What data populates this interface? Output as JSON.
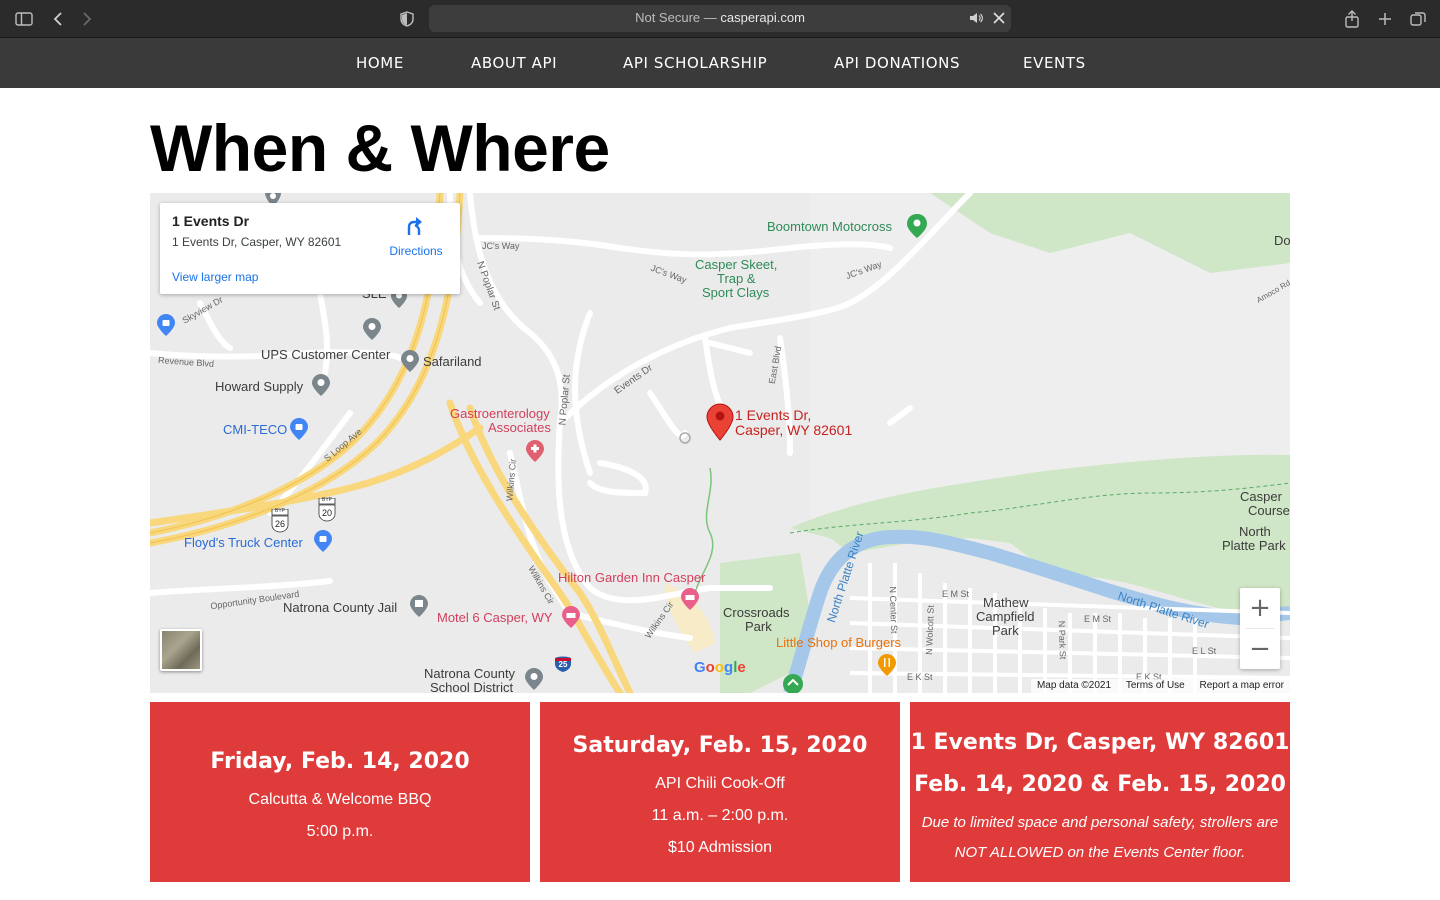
{
  "browser": {
    "url_prefix": "Not Secure — ",
    "url_host": "casperapi.com"
  },
  "nav": {
    "items": [
      "HOME",
      "ABOUT API",
      "API SCHOLARSHIP",
      "API DONATIONS",
      "EVENTS"
    ]
  },
  "page": {
    "title": "When & Where"
  },
  "map": {
    "info": {
      "name": "1 Events Dr",
      "address": "1 Events Dr, Casper, WY 82601",
      "directions": "Directions",
      "larger_map": "View larger map"
    },
    "pin_label_1": "1 Events Dr,",
    "pin_label_2": "Casper, WY 82601",
    "places": {
      "boomtown": "Boomtown Motocross",
      "skeet1": "Casper Skeet,",
      "skeet2": "Trap &",
      "skeet3": "Sport Clays",
      "ups": "UPS Customer Center",
      "safariland": "Safariland",
      "howard": "Howard Supply",
      "cmi": "CMI-TECO",
      "gastro1": "Gastroenterology",
      "gastro2": "Associates",
      "floyds": "Floyd's Truck Center",
      "hilton": "Hilton Garden Inn Casper",
      "natrona_jail": "Natrona County Jail",
      "motel6": "Motel 6 Casper, WY",
      "crossroads1": "Crossroads",
      "crossroads2": "Park",
      "little_shop": "Little Shop of Burgers",
      "mathew1": "Mathew",
      "mathew2": "Campfield",
      "mathew3": "Park",
      "natrona_sd1": "Natrona County",
      "natrona_sd2": "School District",
      "north_platte_park1": "North",
      "north_platte_park2": "Platte Park",
      "casper_course1": "Casper",
      "casper_course2": "Course",
      "do": "Do",
      "sle": "SLE"
    },
    "roads": {
      "jcs_way": "JC's Way",
      "n_poplar": "N Poplar St",
      "events_dr": "Events Dr",
      "east_blvd": "East Blvd",
      "revenue": "Revenue Blvd",
      "skyview": "Skyview Dr",
      "s_loop": "S Loop Ave",
      "wilkins": "Wilkins Cir",
      "opportunity": "Opportunity Boulevard",
      "north_platte_river": "North Platte River",
      "n_center": "N Center St",
      "n_wolcott": "N Wolcott St",
      "n_park": "N Park St",
      "e_m_st": "E M St",
      "e_l_st": "E L St",
      "e_k_st": "E K St",
      "amoco": "Amoco Rd",
      "byp26": "26",
      "byp20": "20",
      "i25": "25",
      "byp": "BYP"
    },
    "attribution": [
      "Map data ©2021",
      "Terms of Use",
      "Report a map error"
    ],
    "google": "Google"
  },
  "events": [
    {
      "date": "Friday, Feb. 14, 2020",
      "lines": [
        "Calcutta & Welcome BBQ",
        "5:00 p.m."
      ]
    },
    {
      "date": "Saturday, Feb. 15, 2020",
      "lines": [
        "API Chili Cook-Off",
        "11 a.m. – 2:00 p.m.",
        "$10 Admission"
      ]
    },
    {
      "address": "1 Events Dr, Casper, WY 82601",
      "dates": "Feb. 14, 2020 & Feb. 15, 2020",
      "note_1": "Due to limited space and personal safety, strollers are",
      "note_2": "NOT ALLOWED on the Events Center floor."
    }
  ],
  "colors": {
    "nav_bg": "#3a3a3a",
    "card_red": "#e03b3b",
    "map_bg": "#ebebeb",
    "highway": "#f8d77d",
    "river": "#a5c8ea",
    "park": "#cfe7c6"
  }
}
